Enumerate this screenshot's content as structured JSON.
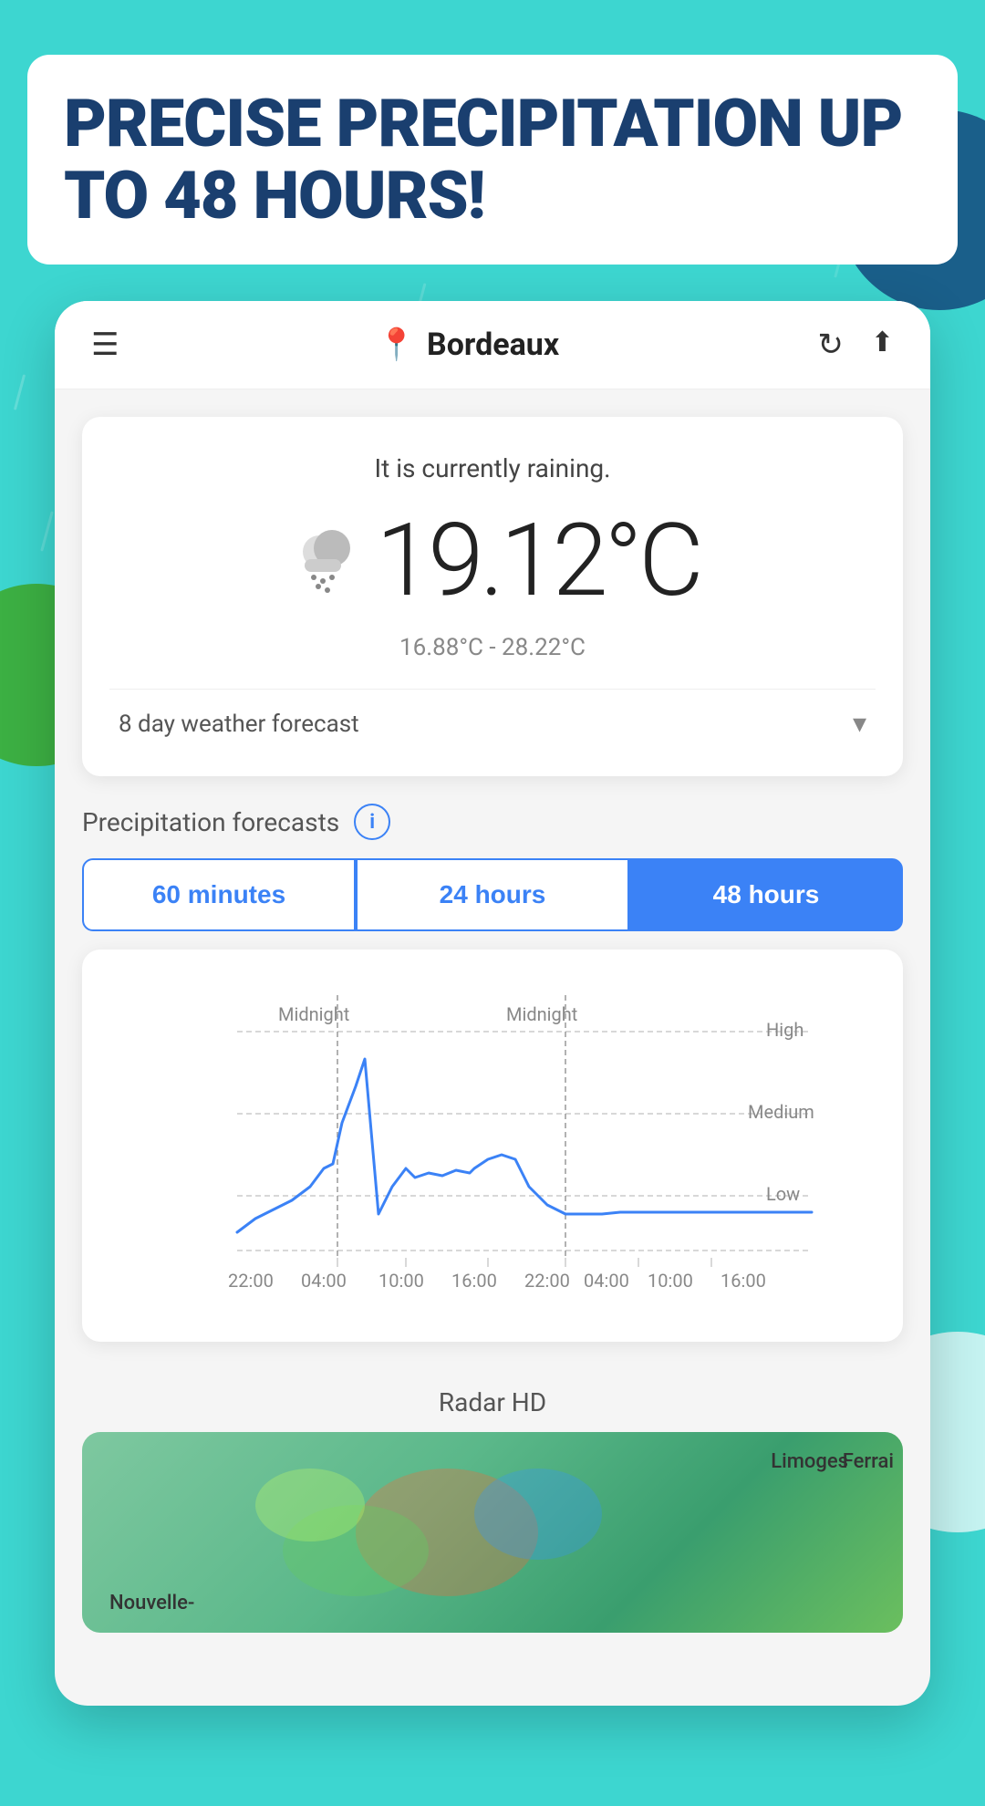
{
  "hero": {
    "title": "PRECISE PRECIPITATION UP TO 48 HOURS!"
  },
  "nav": {
    "location": "Bordeaux",
    "location_pin": "📍",
    "menu_icon": "☰",
    "refresh_icon": "↻",
    "share_icon": "⬆"
  },
  "weather": {
    "status": "It is currently raining.",
    "temperature": "19.12°C",
    "temp_range": "16.88°C - 28.22°C",
    "forecast_label": "8 day weather forecast"
  },
  "precipitation": {
    "section_title": "Precipitation forecasts",
    "tabs": [
      "60 minutes",
      "24 hours",
      "48 hours"
    ],
    "active_tab": 2,
    "chart": {
      "y_labels": [
        "High",
        "Medium",
        "Low"
      ],
      "x_labels": [
        "22:00",
        "04:00",
        "10:00",
        "16:00",
        "22:00",
        "04:00",
        "10:00",
        "16:00"
      ],
      "midnight_labels": [
        "Midnight",
        "Midnight"
      ]
    }
  },
  "radar": {
    "title": "Radar HD",
    "map_labels": [
      "Limoges",
      "Ferrai",
      "Nouvelle-"
    ]
  }
}
